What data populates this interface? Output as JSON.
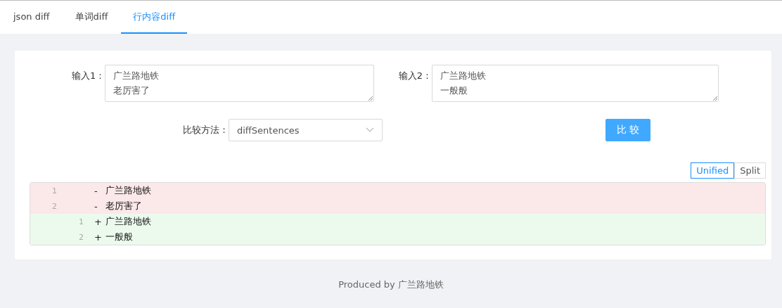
{
  "tabs": [
    {
      "label": "json diff",
      "selected": false
    },
    {
      "label": "单词diff",
      "selected": false
    },
    {
      "label": "行内容diff",
      "selected": true
    }
  ],
  "inputs": [
    {
      "label": "输入1：",
      "lines": [
        "广兰路地铁",
        "老厉害了"
      ]
    },
    {
      "label": "输入2：",
      "lines": [
        "广兰路地铁",
        "一般般"
      ]
    }
  ],
  "method": {
    "label": "比较方法：",
    "value": "diffSentences"
  },
  "compare_button": "比 较",
  "view_modes": [
    {
      "label": "Unified",
      "selected": true
    },
    {
      "label": "Split",
      "selected": false
    }
  ],
  "diff_rows": [
    {
      "kind": "removed",
      "old_line": "1",
      "sign": "-",
      "text": "广兰路地铁"
    },
    {
      "kind": "removed",
      "old_line": "2",
      "sign": "-",
      "text": "老厉害了"
    },
    {
      "kind": "added",
      "new_line": "1",
      "sign": "+",
      "text": "广兰路地铁"
    },
    {
      "kind": "added",
      "new_line": "2",
      "sign": "+",
      "text": "一般般"
    }
  ],
  "footer": "Produced by 广兰路地铁"
}
